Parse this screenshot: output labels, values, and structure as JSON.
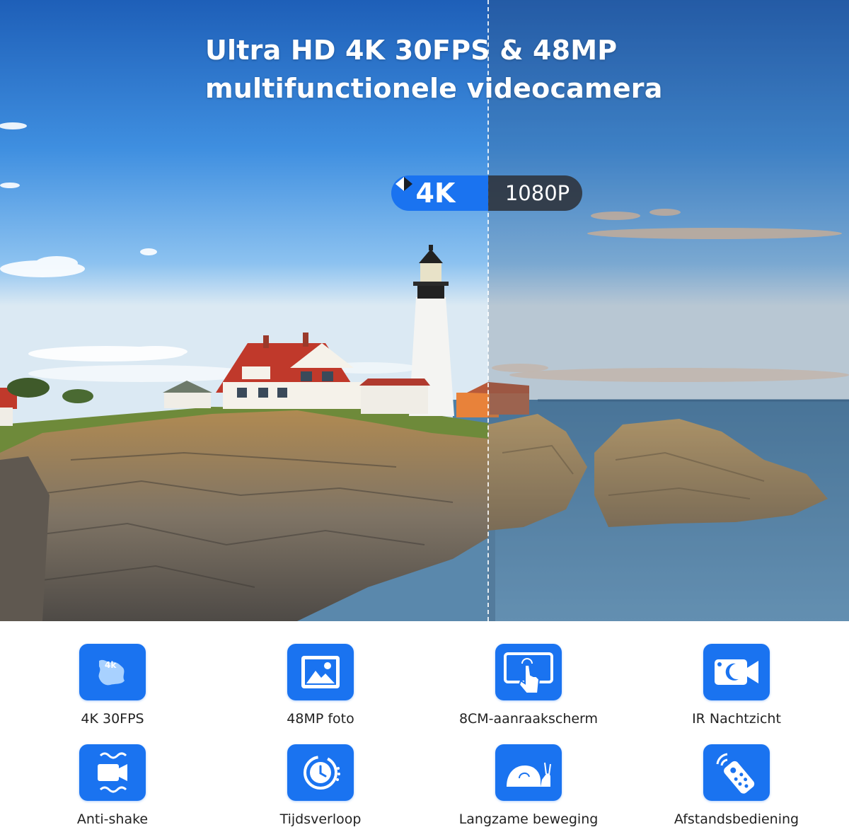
{
  "headline": {
    "line1": "Ultra HD 4K 30FPS & 48MP",
    "line2": "multifunctionele videocamera"
  },
  "comparison": {
    "left_label": "4K",
    "right_label": "1080P",
    "accent_color": "#1a73f0"
  },
  "features": [
    {
      "label": "4K 30FPS",
      "icon": "4k-icon"
    },
    {
      "label": "48MP foto",
      "icon": "photo-icon"
    },
    {
      "label": "8CM-aanraakscherm",
      "icon": "touchscreen-icon"
    },
    {
      "label": "IR Nachtzicht",
      "icon": "night-vision-icon"
    },
    {
      "label": "Anti-shake",
      "icon": "anti-shake-icon"
    },
    {
      "label": "Tijdsverloop",
      "icon": "timelapse-icon"
    },
    {
      "label": "Langzame beweging",
      "icon": "slow-motion-icon"
    },
    {
      "label": "Afstandsbediening",
      "icon": "remote-control-icon"
    }
  ]
}
